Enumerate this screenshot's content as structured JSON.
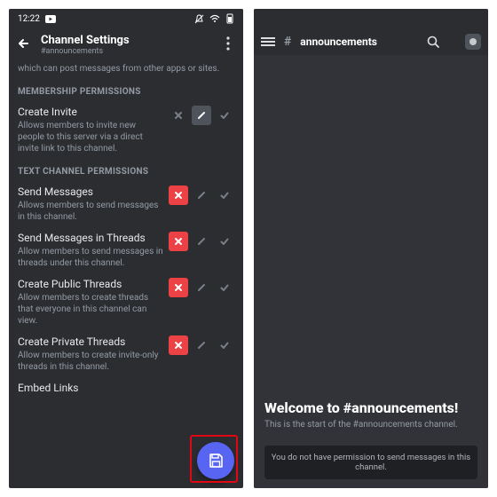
{
  "left": {
    "statusbar": {
      "time": "12:22"
    },
    "header": {
      "title": "Channel Settings",
      "subtitle": "#announcements"
    },
    "intro": "which can post messages from other apps or sites.",
    "sections": {
      "membership": "MEMBERSHIP PERMISSIONS",
      "text": "TEXT CHANNEL PERMISSIONS"
    },
    "perms": {
      "create_invite": {
        "title": "Create Invite",
        "desc": "Allows members to invite new people to this server via a direct invite link to this channel.",
        "state": "slash"
      },
      "send_messages": {
        "title": "Send Messages",
        "desc": "Allows members to send messages in this channel.",
        "state": "deny"
      },
      "send_messages_threads": {
        "title": "Send Messages in Threads",
        "desc": "Allow members to send messages in threads under this channel.",
        "state": "deny"
      },
      "create_public_threads": {
        "title": "Create Public Threads",
        "desc": "Allow members to create threads that everyone in this channel can view.",
        "state": "deny"
      },
      "create_private_threads": {
        "title": "Create Private Threads",
        "desc": "Allow members to create invite-only threads in this channel.",
        "state": "deny"
      },
      "embed_links": {
        "title": "Embed Links",
        "desc": ""
      }
    }
  },
  "right": {
    "channel": "announcements",
    "welcome": "Welcome to #announcements!",
    "subtitle": "This is the start of the #announcements channel.",
    "noperm": "You do not have permission to send messages in this channel."
  }
}
